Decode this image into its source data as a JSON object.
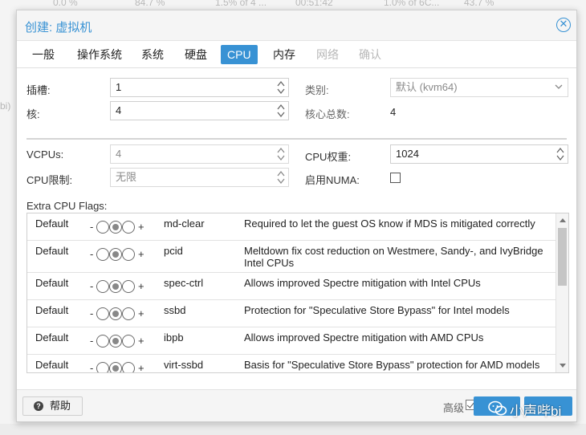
{
  "background": {
    "top_values": [
      "0.0 %",
      "84.7 %",
      "1.5% of 4 ...",
      "00:51:42",
      "1.0% of 6C...",
      "43.7 %"
    ],
    "left_fragment": "bi)"
  },
  "dialog": {
    "title": "创建: 虚拟机",
    "tabs": [
      {
        "label": "一般",
        "state": "normal"
      },
      {
        "label": "操作系统",
        "state": "normal"
      },
      {
        "label": "系统",
        "state": "normal"
      },
      {
        "label": "硬盘",
        "state": "normal"
      },
      {
        "label": "CPU",
        "state": "active"
      },
      {
        "label": "内存",
        "state": "normal"
      },
      {
        "label": "网络",
        "state": "disabled"
      },
      {
        "label": "确认",
        "state": "disabled"
      }
    ]
  },
  "cpu": {
    "sockets_label": "插槽:",
    "sockets_value": "1",
    "cores_label": "核:",
    "cores_value": "4",
    "type_label": "类别:",
    "type_value": "默认 (kvm64)",
    "total_cores_label": "核心总数:",
    "total_cores_value": "4",
    "vcpus_label": "VCPUs:",
    "vcpus_value": "4",
    "cpu_weight_label": "CPU权重:",
    "cpu_weight_value": "1024",
    "cpu_limit_label": "CPU限制:",
    "cpu_limit_value": "无限",
    "numa_label": "启用NUMA:",
    "numa_checked": false
  },
  "flags": {
    "heading": "Extra CPU Flags:",
    "rows": [
      {
        "state": "Default",
        "minus": "-",
        "plus": "+",
        "flag": "md-clear",
        "description": "Required to let the guest OS know if MDS is mitigated correctly"
      },
      {
        "state": "Default",
        "minus": "-",
        "plus": "+",
        "flag": "pcid",
        "description": "Meltdown fix cost reduction on Westmere, Sandy-, and IvyBridge Intel CPUs"
      },
      {
        "state": "Default",
        "minus": "-",
        "plus": "+",
        "flag": "spec-ctrl",
        "description": "Allows improved Spectre mitigation with Intel CPUs"
      },
      {
        "state": "Default",
        "minus": "-",
        "plus": "+",
        "flag": "ssbd",
        "description": "Protection for \"Speculative Store Bypass\" for Intel models"
      },
      {
        "state": "Default",
        "minus": "-",
        "plus": "+",
        "flag": "ibpb",
        "description": "Allows improved Spectre mitigation with AMD CPUs"
      },
      {
        "state": "Default",
        "minus": "-",
        "plus": "+",
        "flag": "virt-ssbd",
        "description": "Basis for \"Speculative Store Bypass\" protection for AMD models"
      }
    ]
  },
  "footer": {
    "help_label": "帮助",
    "advanced_label": "高级",
    "advanced_checked": true
  },
  "watermark": {
    "text": "小声哔bi",
    "icon": "wechat-icon"
  },
  "colors": {
    "accent": "#3892d4",
    "disabled_text": "#b8b8b8"
  }
}
